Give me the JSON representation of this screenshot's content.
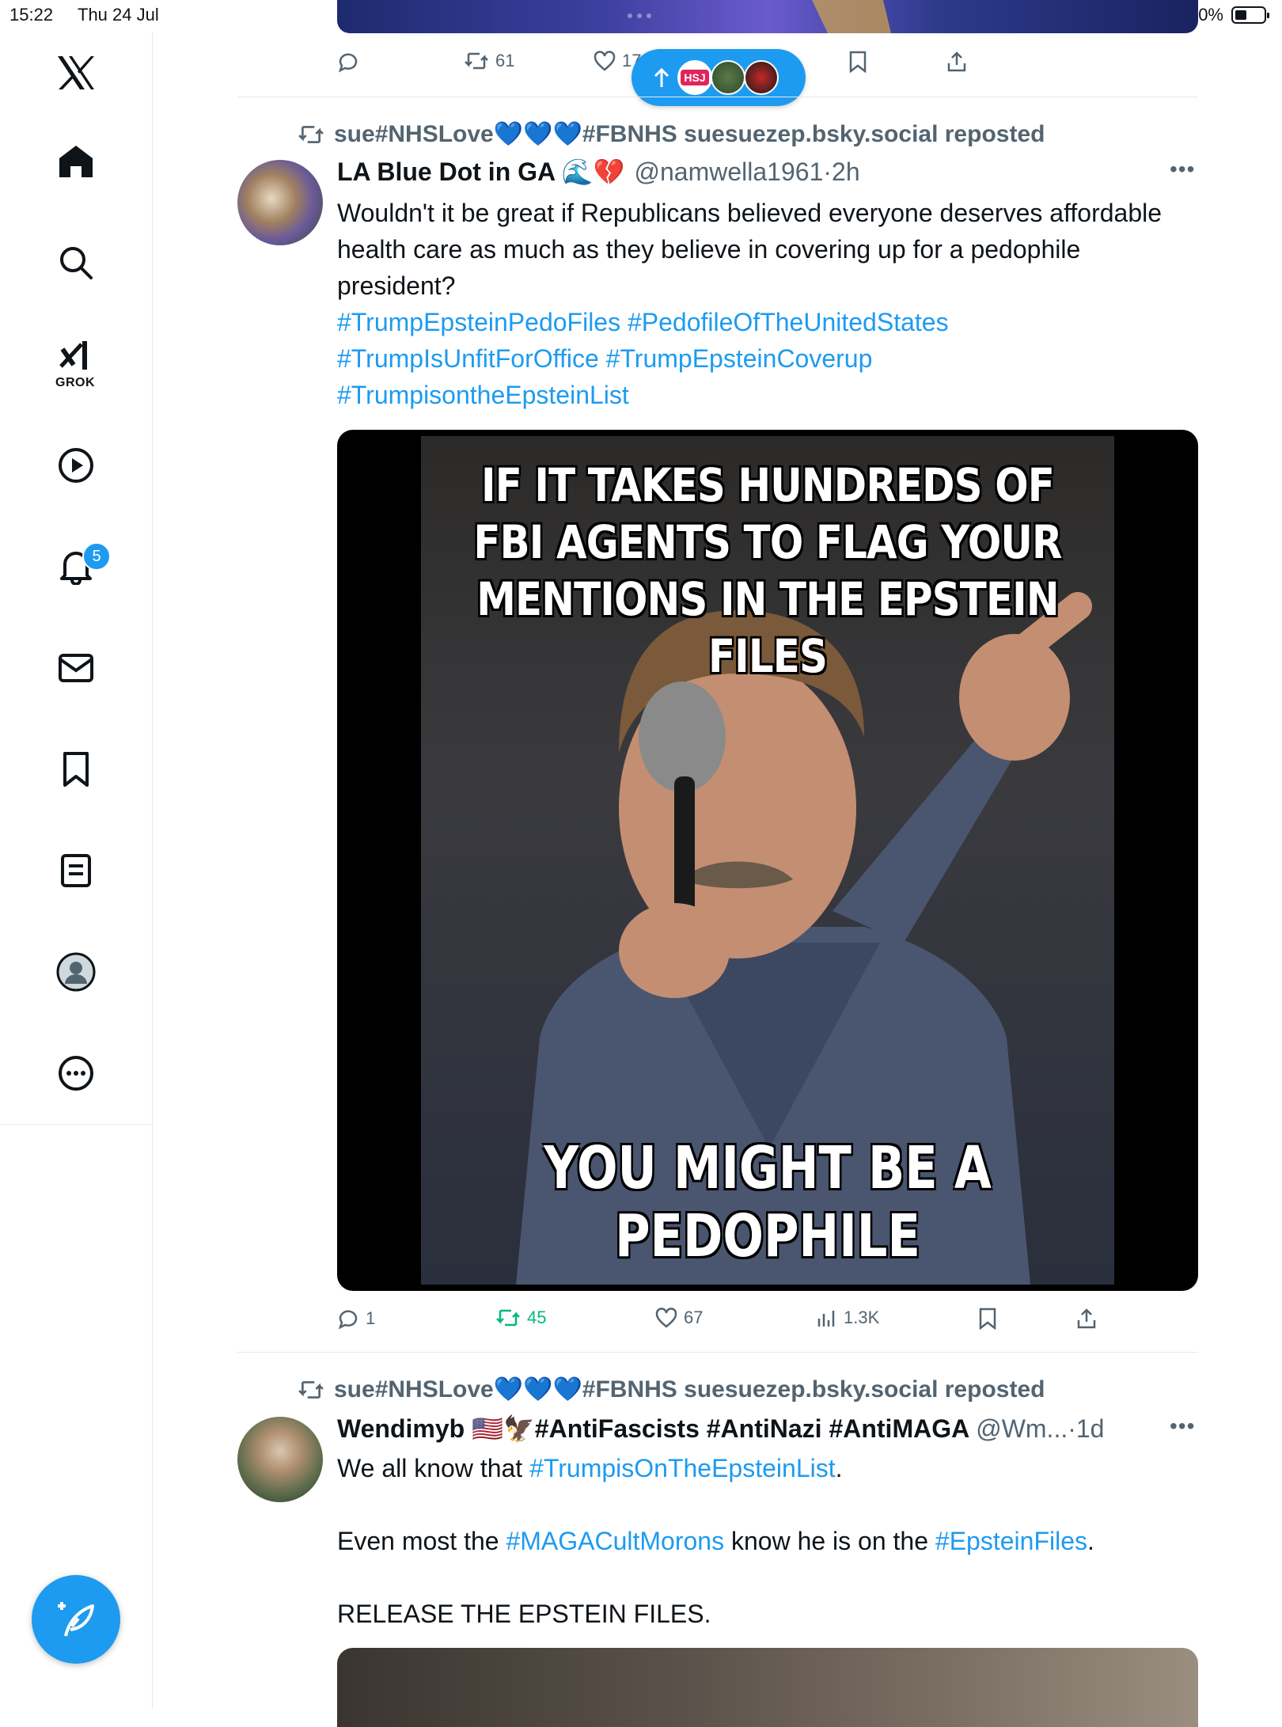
{
  "status_bar": {
    "time": "15:22",
    "date": "Thu 24 Jul",
    "battery": "40%"
  },
  "sidebar": {
    "items": [
      {
        "icon": "x-logo-icon"
      },
      {
        "icon": "home-icon"
      },
      {
        "icon": "search-icon"
      },
      {
        "icon": "grok-icon",
        "label": "GROK"
      },
      {
        "icon": "video-play-icon"
      },
      {
        "icon": "notifications-bell-icon",
        "badge": "5"
      },
      {
        "icon": "messages-envelope-icon"
      },
      {
        "icon": "bookmarks-icon"
      },
      {
        "icon": "lists-icon"
      },
      {
        "icon": "profile-avatar-icon"
      },
      {
        "icon": "more-circle-icon"
      }
    ],
    "compose_icon": "compose-feather-icon"
  },
  "previous_post": {
    "actions": {
      "replies": "",
      "reposts": "61",
      "likes": "17"
    }
  },
  "new_posts_pill": {
    "label": "HSJ"
  },
  "post1": {
    "repost_by": "sue#NHSLove💙💙💙#FBNHS suesuezep.bsky.social reposted",
    "display_name": "LA Blue Dot in GA 🌊💔",
    "handle": "@namwella1961",
    "time": "2h",
    "text_plain": "Wouldn't it be great if Republicans believed everyone deserves affordable health care as much as they believe in covering up for a pedophile president?",
    "hashtags_line1": [
      "#TrumpEpsteinPedoFiles",
      "#PedofileOfTheUnitedStates"
    ],
    "hashtags_line2": [
      "#TrumpIsUnfitForOffice",
      "#TrumpEpsteinCoverup"
    ],
    "hashtags_line3": [
      "#TrumpisontheEpsteinList"
    ],
    "meme_top": "IF IT TAKES HUNDREDS OF FBI AGENTS TO FLAG YOUR MENTIONS IN THE EPSTEIN FILES",
    "meme_bottom": "YOU MIGHT BE A PEDOPHILE",
    "actions": {
      "replies": "1",
      "reposts": "45",
      "likes": "67",
      "views": "1.3K"
    }
  },
  "post2": {
    "repost_by": "sue#NHSLove💙💙💙#FBNHS suesuezep.bsky.social reposted",
    "display_name": "Wendimyb 🇺🇸🦅#AntiFascists #AntiNazi #AntiMAGA",
    "handle": "@Wm...",
    "time": "1d",
    "line1_prefix": "We all know that ",
    "line1_tag": "#TrumpisOnTheEpsteinList",
    "line1_suffix": ".",
    "line2_prefix": "Even most the ",
    "line2_tag1": "#MAGACultMorons",
    "line2_mid": " know he is on the ",
    "line2_tag2": "#EpsteinFiles",
    "line2_suffix": ".",
    "line3": "RELEASE THE EPSTEIN FILES."
  },
  "colors": {
    "accent": "#1d9bf0",
    "repost_green": "#00ba7c",
    "muted": "#536471"
  }
}
